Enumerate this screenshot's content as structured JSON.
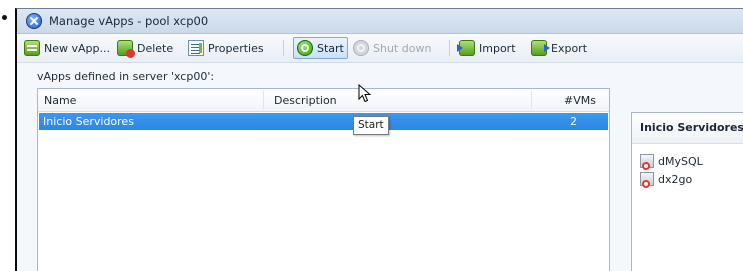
{
  "window": {
    "title": "Manage vApps - pool xcp00"
  },
  "toolbar": {
    "new_label": "New vApp...",
    "delete_label": "Delete",
    "properties_label": "Properties",
    "start_label": "Start",
    "shutdown_label": "Shut down",
    "import_label": "Import",
    "export_label": "Export",
    "hovered": "Start",
    "disabled": [
      "Shut down"
    ]
  },
  "main": {
    "section_label": "vApps defined in server 'xcp00':",
    "columns": [
      "Name",
      "Description",
      "#VMs"
    ],
    "rows": [
      {
        "name": "Inicio Servidores",
        "description": "",
        "vms": "2",
        "selected": true
      }
    ]
  },
  "tooltip": {
    "text": "Start"
  },
  "side_panel": {
    "title": "Inicio Servidores",
    "vms": [
      "dMySQL",
      "dx2go"
    ]
  },
  "icons": {
    "app": "vapp-manager-icon",
    "new": "new-vapp-icon",
    "delete": "delete-icon",
    "properties": "properties-icon",
    "start": "start-icon",
    "shutdown": "shutdown-icon",
    "import": "import-icon",
    "export": "export-icon",
    "vm": "vm-icon",
    "cursor": "mouse-pointer-icon"
  },
  "colors": {
    "selection": "#2d86e3",
    "hover_border": "#7fa9d9",
    "disabled_text": "#a3a9b0"
  }
}
